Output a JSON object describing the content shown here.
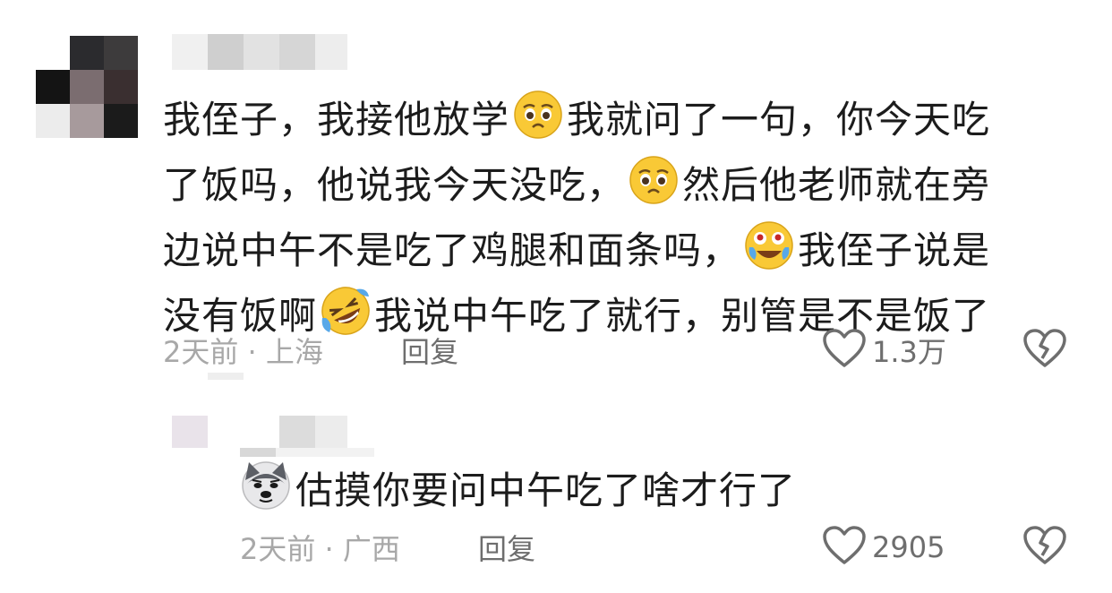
{
  "comments": [
    {
      "text_lines": [
        [
          "我侄子，我接他放学",
          "emoji:pleading",
          "我就问了一句，你今天吃"
        ],
        [
          "了饭吗，他说我今天没吃，",
          "emoji:pleading",
          "然后他老师就在旁"
        ],
        [
          "边说中午不是吃了鸡腿和面条吗，",
          "emoji:joy-tears",
          "我侄子说是"
        ],
        [
          "没有饭啊",
          "emoji:rofl",
          "我说中午吃了就行，别管是不是饭了"
        ]
      ],
      "time_location": "2天前 · 上海",
      "reply_label": "回复",
      "like_count": "1.3万"
    },
    {
      "text": "估摸你要问中午吃了啥才行了",
      "leading_emoji": "husky-dog",
      "time_location": "2天前 · 广西",
      "reply_label": "回复",
      "like_count": "2905"
    }
  ],
  "icons": {
    "like": "heart-outline-icon",
    "dislike": "broken-heart-icon"
  },
  "colors": {
    "text": "#1c1c1c",
    "meta": "#a8a8a8",
    "action": "#6e6e6e",
    "emoji_face": "#f9c936"
  }
}
